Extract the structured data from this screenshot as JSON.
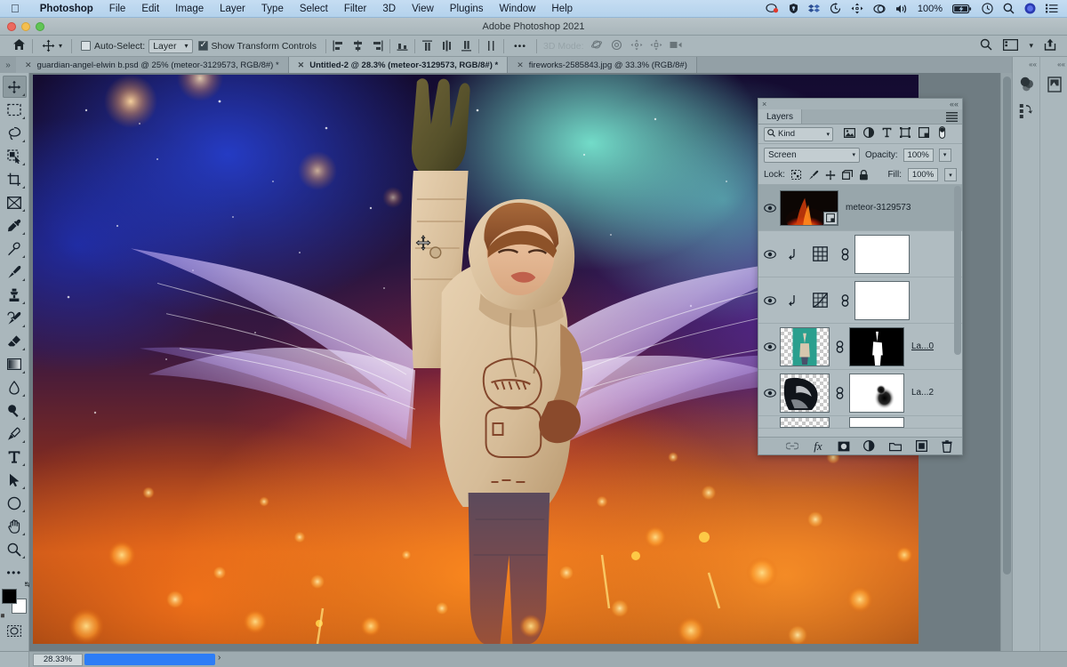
{
  "mac_menu": {
    "apple": "apple-logo",
    "items": [
      "Photoshop",
      "File",
      "Edit",
      "Image",
      "Layer",
      "Type",
      "Select",
      "Filter",
      "3D",
      "View",
      "Plugins",
      "Window",
      "Help"
    ],
    "status_icons": [
      "screen-record-icon",
      "shield-icon",
      "dropbox-icon",
      "time-machine-icon",
      "display-arrows-icon",
      "cloud-sync-icon",
      "volume-icon",
      "clock-icon",
      "spotlight-search-icon",
      "siri-icon",
      "control-center-icon"
    ],
    "battery_percent": "100%"
  },
  "window": {
    "title": "Adobe Photoshop 2021"
  },
  "options_bar": {
    "home_icon": "home-icon",
    "tool_icon": "move-tool-icon",
    "auto_select_label": "Auto-Select:",
    "auto_select_checked": false,
    "auto_select_value": "Layer",
    "show_transform_label": "Show Transform Controls",
    "show_transform_checked": true,
    "more_label": "•••",
    "mode_3d_label": "3D Mode:",
    "right_icons": [
      "search-icon",
      "workspace-icon",
      "chevron-down-icon",
      "share-icon"
    ]
  },
  "tabs": [
    {
      "title": "guardian-angel-elwin b.psd @ 25% (meteor-3129573, RGB/8#) *",
      "active": false
    },
    {
      "title": "Untitled-2 @ 28.3% (meteor-3129573, RGB/8#) *",
      "active": true
    },
    {
      "title": "fireworks-2585843.jpg @ 33.3% (RGB/8#)",
      "active": false
    }
  ],
  "toolbar": {
    "tools": [
      {
        "name": "move-tool",
        "selected": true
      },
      {
        "name": "rectangular-marquee-tool",
        "selected": false
      },
      {
        "name": "lasso-tool",
        "selected": false
      },
      {
        "name": "quick-selection-tool",
        "selected": false
      },
      {
        "name": "crop-tool",
        "selected": false
      },
      {
        "name": "frame-tool",
        "selected": false
      },
      {
        "name": "eyedropper-tool",
        "selected": false
      },
      {
        "name": "spot-healing-brush-tool",
        "selected": false
      },
      {
        "name": "brush-tool",
        "selected": false
      },
      {
        "name": "clone-stamp-tool",
        "selected": false
      },
      {
        "name": "history-brush-tool",
        "selected": false
      },
      {
        "name": "eraser-tool",
        "selected": false
      },
      {
        "name": "gradient-tool",
        "selected": false
      },
      {
        "name": "blur-tool",
        "selected": false
      },
      {
        "name": "dodge-tool",
        "selected": false
      },
      {
        "name": "pen-tool",
        "selected": false
      },
      {
        "name": "horizontal-type-tool",
        "selected": false
      },
      {
        "name": "path-selection-tool",
        "selected": false
      },
      {
        "name": "ellipse-tool",
        "selected": false
      },
      {
        "name": "hand-tool",
        "selected": false
      },
      {
        "name": "zoom-tool",
        "selected": false
      },
      {
        "name": "edit-toolbar-tool",
        "selected": false
      }
    ],
    "foreground_color": "#000000",
    "background_color": "#ffffff"
  },
  "layers_panel": {
    "tab_label": "Layers",
    "close_label": "×",
    "collapse_label": "««",
    "filter": {
      "icon": "search-icon",
      "value": "Kind",
      "type_icons": [
        "pixel-layer-filter-icon",
        "adjustment-layer-filter-icon",
        "type-layer-filter-icon",
        "shape-layer-filter-icon",
        "smart-object-filter-icon",
        "filter-toggle-icon"
      ]
    },
    "blend_mode": "Screen",
    "opacity_label": "Opacity:",
    "opacity_value": "100%",
    "lock_label": "Lock:",
    "lock_icons": [
      "lock-transparent-pixels-icon",
      "lock-image-pixels-icon",
      "lock-position-icon",
      "lock-artboard-icon",
      "lock-all-icon"
    ],
    "fill_label": "Fill:",
    "fill_value": "100%",
    "layers": [
      {
        "name": "meteor-3129573",
        "visible": true,
        "selected": true,
        "kind": "image-with-smartobject",
        "has_mask": false
      },
      {
        "name": "",
        "visible": true,
        "selected": false,
        "kind": "adjustment-gradient-map",
        "has_mask": true,
        "clipped": true
      },
      {
        "name": "",
        "visible": true,
        "selected": false,
        "kind": "adjustment-curves",
        "has_mask": true,
        "clipped": true
      },
      {
        "name": "La...0",
        "visible": true,
        "selected": false,
        "kind": "image-boy",
        "has_mask": true,
        "underlined": true
      },
      {
        "name": "La...2",
        "visible": true,
        "selected": false,
        "kind": "image-dark",
        "has_mask": true,
        "underlined": false
      }
    ],
    "bottom_icons": [
      "link-layers-icon",
      "add-layer-style-fx-icon",
      "add-layer-mask-icon",
      "new-adjustment-layer-icon",
      "new-group-icon",
      "new-layer-icon",
      "delete-layer-icon"
    ]
  },
  "right_dock": {
    "collapse_label": "««",
    "column_a_icons": [
      "color-wheel-icon",
      "libraries-icon"
    ],
    "column_b_icons": [
      "adjustments-icon"
    ]
  },
  "status_bar": {
    "zoom_value": "28.33%",
    "scroll_arrow": "›"
  }
}
